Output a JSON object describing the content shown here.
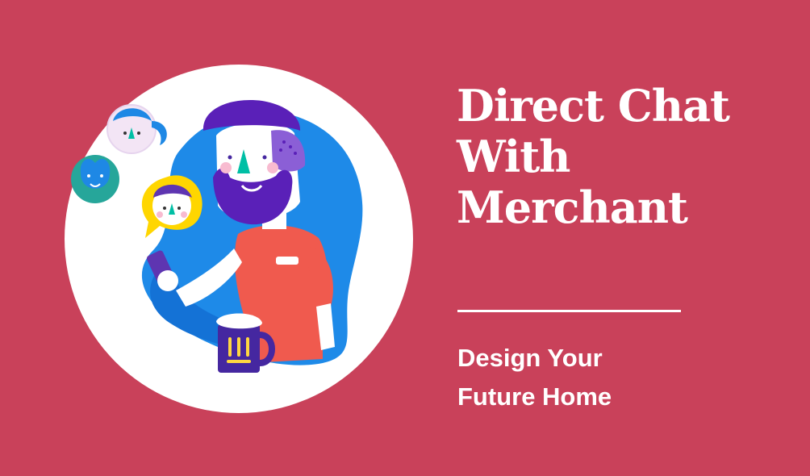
{
  "background_color": "#c9415a",
  "illustration": {
    "description_icon": "person-chatting-on-phone-illustration",
    "circle_color": "#ffffff"
  },
  "heading": {
    "lines": [
      "Direct Chat",
      "With",
      "Merchant"
    ]
  },
  "subheading": {
    "lines": [
      "Design Your",
      "Future Home"
    ]
  }
}
